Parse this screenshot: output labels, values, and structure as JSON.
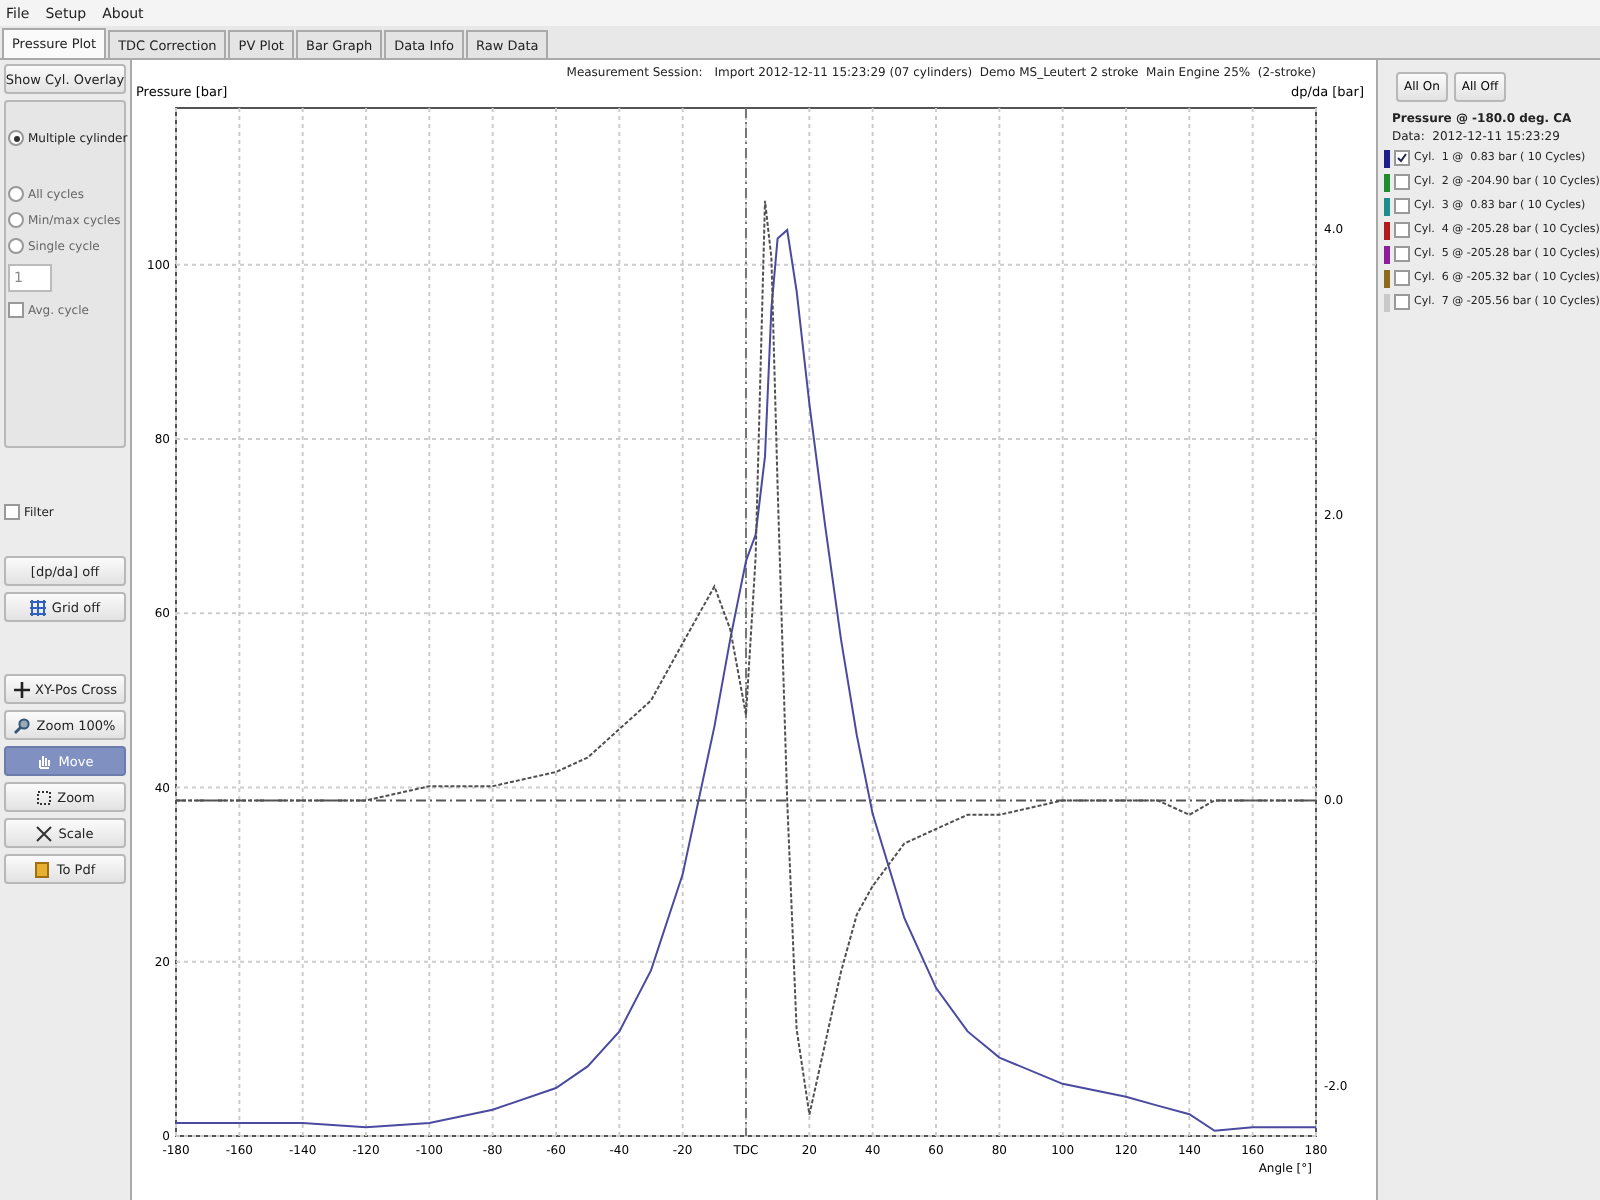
{
  "menu": [
    "File",
    "Setup",
    "About"
  ],
  "tabs": [
    {
      "label": "Pressure Plot",
      "selected": true
    },
    {
      "label": "TDC Correction",
      "selected": false
    },
    {
      "label": "PV Plot",
      "selected": false
    },
    {
      "label": "Bar Graph",
      "selected": false
    },
    {
      "label": "Data Info",
      "selected": false
    },
    {
      "label": "Raw Data",
      "selected": false
    }
  ],
  "left_panel": {
    "overlay_button": "Show Cyl. Overlay",
    "options": [
      {
        "kind": "radio",
        "label": "Multiple cylinder",
        "selected": true,
        "disabled": false
      },
      {
        "kind": "gap"
      },
      {
        "kind": "radio",
        "label": "All cycles",
        "selected": false,
        "disabled": true
      },
      {
        "kind": "radio",
        "label": "Min/max cycles",
        "selected": false,
        "disabled": true
      },
      {
        "kind": "radio",
        "label": "Single cycle",
        "selected": false,
        "disabled": true
      },
      {
        "kind": "spin",
        "value": "1",
        "disabled": true
      },
      {
        "kind": "checkbox",
        "label": "Avg. cycle",
        "checked": false,
        "disabled": true
      }
    ],
    "filter": {
      "label": "Filter",
      "checked": false
    },
    "toggles": [
      {
        "label": "[dp/da] off"
      },
      {
        "label": "Grid off"
      }
    ],
    "tools": [
      {
        "label": "XY-Pos Cross",
        "selected": false
      },
      {
        "label": "Zoom 100%",
        "selected": false
      },
      {
        "label": "Move",
        "selected": true
      },
      {
        "label": "Zoom",
        "selected": false
      },
      {
        "label": "Scale",
        "selected": false
      },
      {
        "label": "To Pdf",
        "selected": false
      }
    ]
  },
  "plot_header": {
    "label": "Measurement Session:",
    "session": "Import 2012-12-11 15:23:29 (07 cylinders)  Demo MS_Leutert 2 stroke  Main Engine 25%  (2-stroke)"
  },
  "pressure_plot": {
    "chart_data": {
      "type": "line",
      "ylabel": "Pressure [bar]",
      "xlabel": "Angle [°]",
      "xlim": [
        -180,
        180
      ],
      "ylim": [
        0,
        118
      ],
      "grid": true,
      "xticks": [
        -180,
        -160,
        -140,
        -120,
        -100,
        -80,
        -60,
        -40,
        -20,
        {
          "value": 0,
          "label": "TDC"
        },
        20,
        40,
        60,
        80,
        100,
        120,
        140,
        160,
        180
      ],
      "yticks": [
        0,
        20,
        40,
        60,
        80,
        100
      ],
      "ref_lines": [
        {
          "axis": "x",
          "value": 0,
          "line_style": "dashdot"
        }
      ],
      "x": [
        -180,
        -140,
        -120,
        -100,
        -80,
        -60,
        -50,
        -40,
        -30,
        -20,
        -10,
        -5,
        0,
        3,
        6,
        8,
        10,
        13,
        16,
        20,
        25,
        30,
        35,
        40,
        50,
        60,
        70,
        80,
        100,
        120,
        130,
        140,
        148,
        160,
        180
      ],
      "series": [
        {
          "color": "#4a4aa0",
          "line_style": "solid",
          "values": [
            1.5,
            1.5,
            1,
            1.5,
            3,
            5.5,
            8,
            12,
            19,
            30,
            47,
            57,
            66,
            69,
            78,
            95,
            103,
            104,
            97,
            84,
            70,
            57,
            46,
            37,
            25,
            17,
            12,
            9,
            6,
            4.5,
            3.5,
            2.5,
            0.6,
            1,
            1
          ]
        }
      ]
    }
  },
  "derivative_plot": {
    "chart_data": {
      "type": "line",
      "ylabel": "dp/da [bar]",
      "xlim": [
        -180,
        180
      ],
      "ylim": [
        -2.35,
        4.85
      ],
      "yticks": [
        {
          "value": 4,
          "label": "4.0"
        },
        {
          "value": 2,
          "label": "2.0"
        },
        {
          "value": 0,
          "label": "0.0"
        },
        {
          "value": -2,
          "label": "-2.0"
        }
      ],
      "ref_lines": [
        {
          "axis": "y",
          "value": 0,
          "line_style": "dashdot"
        }
      ],
      "x": [
        -180,
        -140,
        -120,
        -100,
        -80,
        -60,
        -50,
        -40,
        -30,
        -20,
        -10,
        -5,
        0,
        3,
        6,
        8,
        10,
        13,
        16,
        20,
        25,
        30,
        35,
        40,
        50,
        60,
        70,
        80,
        100,
        120,
        130,
        140,
        148,
        160,
        180
      ],
      "series": [
        {
          "color": "#505050",
          "line_style": "dashed",
          "values": [
            0,
            0,
            0,
            0.1,
            0.1,
            0.2,
            0.3,
            0.5,
            0.7,
            1.1,
            1.5,
            1.2,
            0.6,
            1.7,
            4.2,
            3.8,
            2.2,
            0,
            -1.6,
            -2.2,
            -1.7,
            -1.2,
            -0.8,
            -0.6,
            -0.3,
            -0.2,
            -0.1,
            -0.1,
            0,
            0,
            0,
            -0.1,
            0,
            0,
            0
          ]
        }
      ]
    }
  },
  "right_panel": {
    "buttons": [
      "All On",
      "All Off"
    ],
    "title": "Pressure @ -180.0 deg. CA",
    "data_label": "Data:  2012-12-11 15:23:29",
    "cylinders": [
      {
        "label": "Cyl.  1 @  0.83 bar ( 10 Cycles)",
        "color": "#1c1c8c",
        "checked": true
      },
      {
        "label": "Cyl.  2 @ -204.90 bar ( 10 Cycles)",
        "color": "#1c8c2c",
        "checked": false
      },
      {
        "label": "Cyl.  3 @  0.83 bar ( 10 Cycles)",
        "color": "#1c8c8c",
        "checked": false
      },
      {
        "label": "Cyl.  4 @ -205.28 bar ( 10 Cycles)",
        "color": "#b01c1c",
        "checked": false
      },
      {
        "label": "Cyl.  5 @ -205.28 bar ( 10 Cycles)",
        "color": "#8c1c9c",
        "checked": false
      },
      {
        "label": "Cyl.  6 @ -205.32 bar ( 10 Cycles)",
        "color": "#8c6c1c",
        "checked": false
      },
      {
        "label": "Cyl.  7 @ -205.56 bar ( 10 Cycles)",
        "color": "#c8c8c8",
        "checked": false
      }
    ]
  }
}
